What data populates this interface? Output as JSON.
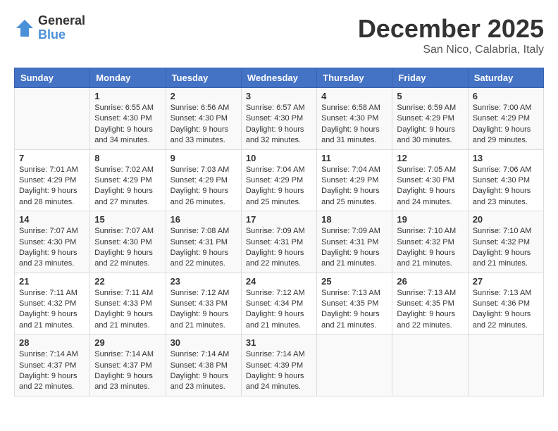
{
  "logo": {
    "general": "General",
    "blue": "Blue"
  },
  "title": "December 2025",
  "location": "San Nico, Calabria, Italy",
  "days_of_week": [
    "Sunday",
    "Monday",
    "Tuesday",
    "Wednesday",
    "Thursday",
    "Friday",
    "Saturday"
  ],
  "weeks": [
    [
      {
        "day": "",
        "content": ""
      },
      {
        "day": "1",
        "content": "Sunrise: 6:55 AM\nSunset: 4:30 PM\nDaylight: 9 hours\nand 34 minutes."
      },
      {
        "day": "2",
        "content": "Sunrise: 6:56 AM\nSunset: 4:30 PM\nDaylight: 9 hours\nand 33 minutes."
      },
      {
        "day": "3",
        "content": "Sunrise: 6:57 AM\nSunset: 4:30 PM\nDaylight: 9 hours\nand 32 minutes."
      },
      {
        "day": "4",
        "content": "Sunrise: 6:58 AM\nSunset: 4:30 PM\nDaylight: 9 hours\nand 31 minutes."
      },
      {
        "day": "5",
        "content": "Sunrise: 6:59 AM\nSunset: 4:29 PM\nDaylight: 9 hours\nand 30 minutes."
      },
      {
        "day": "6",
        "content": "Sunrise: 7:00 AM\nSunset: 4:29 PM\nDaylight: 9 hours\nand 29 minutes."
      }
    ],
    [
      {
        "day": "7",
        "content": "Sunrise: 7:01 AM\nSunset: 4:29 PM\nDaylight: 9 hours\nand 28 minutes."
      },
      {
        "day": "8",
        "content": "Sunrise: 7:02 AM\nSunset: 4:29 PM\nDaylight: 9 hours\nand 27 minutes."
      },
      {
        "day": "9",
        "content": "Sunrise: 7:03 AM\nSunset: 4:29 PM\nDaylight: 9 hours\nand 26 minutes."
      },
      {
        "day": "10",
        "content": "Sunrise: 7:04 AM\nSunset: 4:29 PM\nDaylight: 9 hours\nand 25 minutes."
      },
      {
        "day": "11",
        "content": "Sunrise: 7:04 AM\nSunset: 4:29 PM\nDaylight: 9 hours\nand 25 minutes."
      },
      {
        "day": "12",
        "content": "Sunrise: 7:05 AM\nSunset: 4:30 PM\nDaylight: 9 hours\nand 24 minutes."
      },
      {
        "day": "13",
        "content": "Sunrise: 7:06 AM\nSunset: 4:30 PM\nDaylight: 9 hours\nand 23 minutes."
      }
    ],
    [
      {
        "day": "14",
        "content": "Sunrise: 7:07 AM\nSunset: 4:30 PM\nDaylight: 9 hours\nand 23 minutes."
      },
      {
        "day": "15",
        "content": "Sunrise: 7:07 AM\nSunset: 4:30 PM\nDaylight: 9 hours\nand 22 minutes."
      },
      {
        "day": "16",
        "content": "Sunrise: 7:08 AM\nSunset: 4:31 PM\nDaylight: 9 hours\nand 22 minutes."
      },
      {
        "day": "17",
        "content": "Sunrise: 7:09 AM\nSunset: 4:31 PM\nDaylight: 9 hours\nand 22 minutes."
      },
      {
        "day": "18",
        "content": "Sunrise: 7:09 AM\nSunset: 4:31 PM\nDaylight: 9 hours\nand 21 minutes."
      },
      {
        "day": "19",
        "content": "Sunrise: 7:10 AM\nSunset: 4:32 PM\nDaylight: 9 hours\nand 21 minutes."
      },
      {
        "day": "20",
        "content": "Sunrise: 7:10 AM\nSunset: 4:32 PM\nDaylight: 9 hours\nand 21 minutes."
      }
    ],
    [
      {
        "day": "21",
        "content": "Sunrise: 7:11 AM\nSunset: 4:32 PM\nDaylight: 9 hours\nand 21 minutes."
      },
      {
        "day": "22",
        "content": "Sunrise: 7:11 AM\nSunset: 4:33 PM\nDaylight: 9 hours\nand 21 minutes."
      },
      {
        "day": "23",
        "content": "Sunrise: 7:12 AM\nSunset: 4:33 PM\nDaylight: 9 hours\nand 21 minutes."
      },
      {
        "day": "24",
        "content": "Sunrise: 7:12 AM\nSunset: 4:34 PM\nDaylight: 9 hours\nand 21 minutes."
      },
      {
        "day": "25",
        "content": "Sunrise: 7:13 AM\nSunset: 4:35 PM\nDaylight: 9 hours\nand 21 minutes."
      },
      {
        "day": "26",
        "content": "Sunrise: 7:13 AM\nSunset: 4:35 PM\nDaylight: 9 hours\nand 22 minutes."
      },
      {
        "day": "27",
        "content": "Sunrise: 7:13 AM\nSunset: 4:36 PM\nDaylight: 9 hours\nand 22 minutes."
      }
    ],
    [
      {
        "day": "28",
        "content": "Sunrise: 7:14 AM\nSunset: 4:37 PM\nDaylight: 9 hours\nand 22 minutes."
      },
      {
        "day": "29",
        "content": "Sunrise: 7:14 AM\nSunset: 4:37 PM\nDaylight: 9 hours\nand 23 minutes."
      },
      {
        "day": "30",
        "content": "Sunrise: 7:14 AM\nSunset: 4:38 PM\nDaylight: 9 hours\nand 23 minutes."
      },
      {
        "day": "31",
        "content": "Sunrise: 7:14 AM\nSunset: 4:39 PM\nDaylight: 9 hours\nand 24 minutes."
      },
      {
        "day": "",
        "content": ""
      },
      {
        "day": "",
        "content": ""
      },
      {
        "day": "",
        "content": ""
      }
    ]
  ]
}
